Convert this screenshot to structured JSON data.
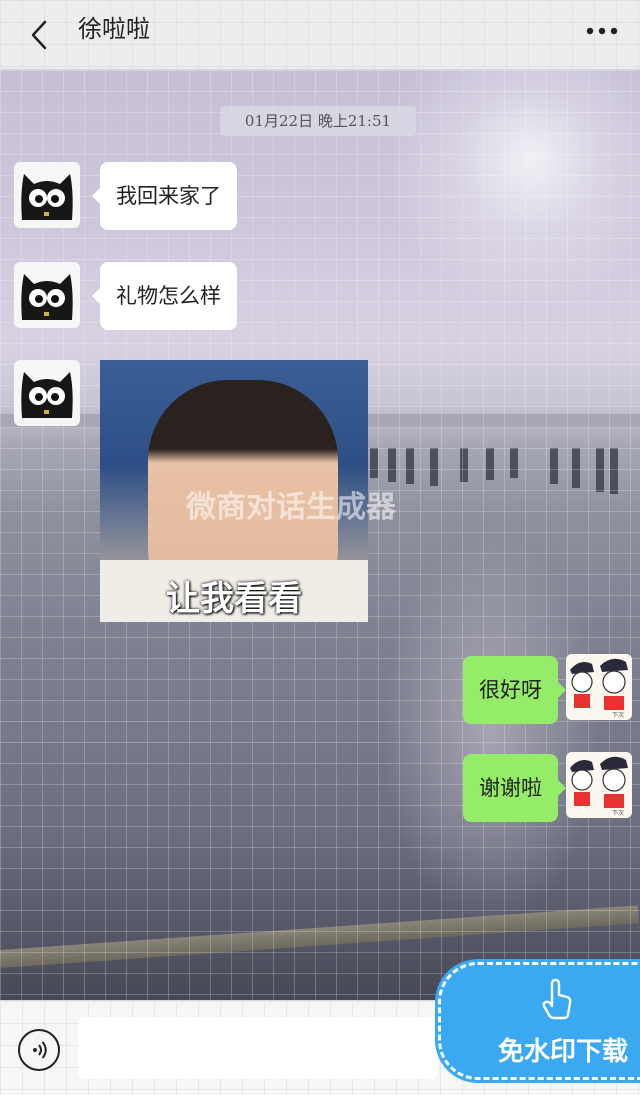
{
  "header": {
    "title": "徐啦啦"
  },
  "chat": {
    "timestamp": "01月22日 晚上21:51",
    "messages": [
      {
        "side": "left",
        "type": "text",
        "text": "我回来家了"
      },
      {
        "side": "left",
        "type": "text",
        "text": "礼物怎么样"
      },
      {
        "side": "left",
        "type": "image",
        "caption": "让我看看"
      },
      {
        "side": "right",
        "type": "text",
        "text": "很好呀"
      },
      {
        "side": "right",
        "type": "text",
        "text": "谢谢啦"
      }
    ],
    "watermark": "微商对话生成器"
  },
  "bottom": {
    "download_label": "免水印下载"
  },
  "icons": {
    "back": "chevron-left-icon",
    "more": "more-dots-icon",
    "voice": "voice-icon",
    "download_hand": "tap-hand-icon"
  },
  "colors": {
    "sent_bubble": "#95ec69",
    "received_bubble": "#ffffff",
    "download_button": "#3aa9f2"
  }
}
